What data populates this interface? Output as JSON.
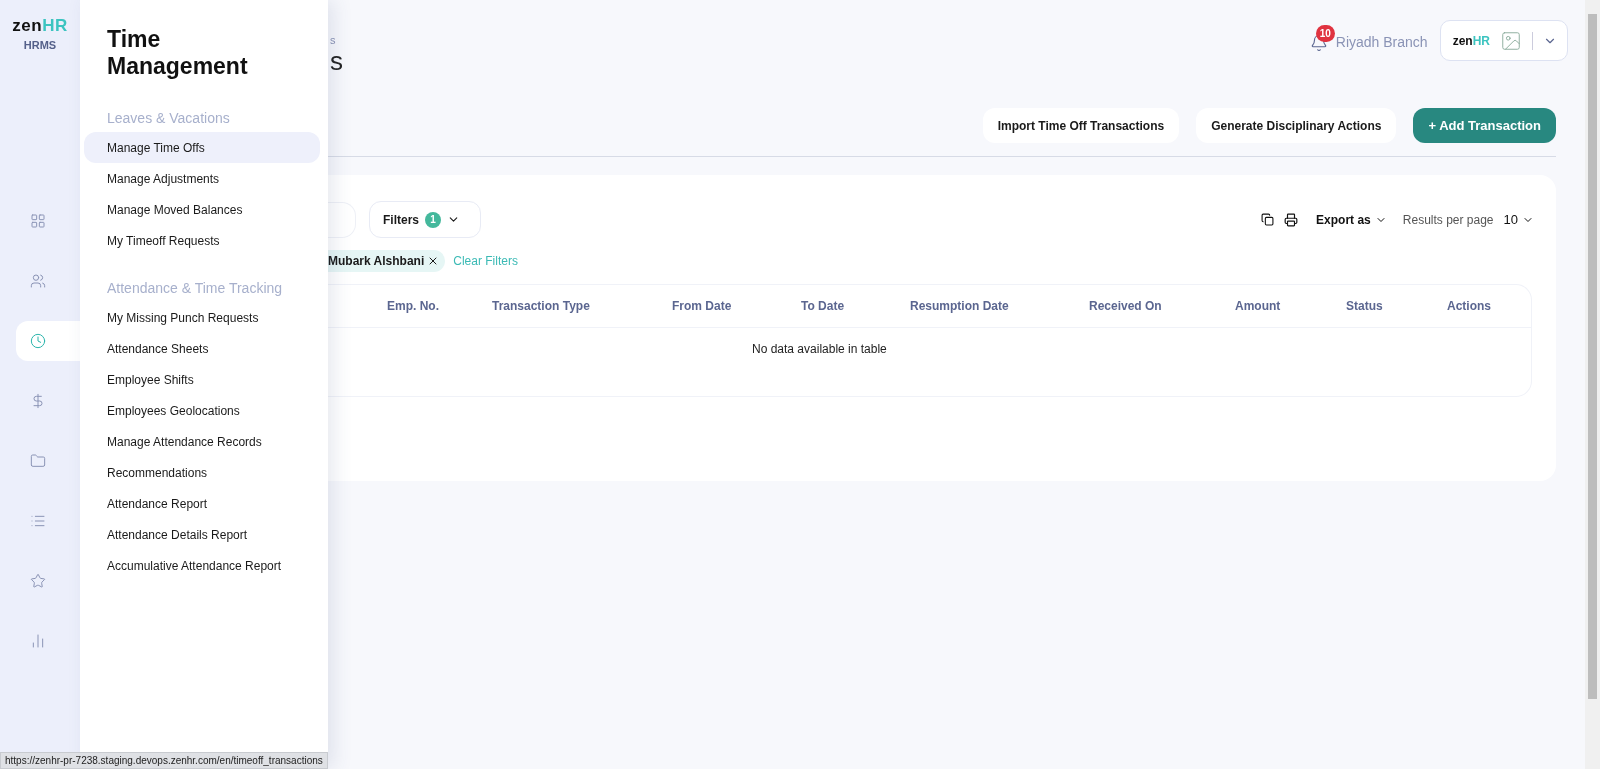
{
  "logo": {
    "part_1": "zen",
    "part_2": "HR",
    "product": "HRMS"
  },
  "rail": [
    {
      "selected": false
    },
    {
      "selected": false
    },
    {
      "selected": true
    },
    {
      "selected": false
    },
    {
      "selected": false
    },
    {
      "selected": false
    },
    {
      "selected": false
    },
    {
      "selected": false
    }
  ],
  "flyout": {
    "title": "Time Management",
    "sections": [
      {
        "heading": "Leaves & Vacations",
        "items": [
          {
            "label": "Manage Time Offs",
            "selected": true
          },
          {
            "label": "Manage Adjustments",
            "selected": false
          },
          {
            "label": "Manage Moved Balances",
            "selected": false
          },
          {
            "label": "My Timeoff Requests",
            "selected": false
          }
        ]
      },
      {
        "heading": "Attendance & Time Tracking",
        "items": [
          {
            "label": "My Missing Punch Requests",
            "selected": false
          },
          {
            "label": "Attendance Sheets",
            "selected": false
          },
          {
            "label": "Employee Shifts",
            "selected": false
          },
          {
            "label": "Employees Geolocations",
            "selected": false
          },
          {
            "label": "Manage Attendance Records",
            "selected": false
          },
          {
            "label": "Recommendations",
            "selected": false
          },
          {
            "label": "Attendance Report",
            "selected": false
          },
          {
            "label": "Attendance Details Report",
            "selected": false
          },
          {
            "label": "Accumulative Attendance Report",
            "selected": false
          }
        ]
      }
    ]
  },
  "header": {
    "breadcrumb": "s",
    "title": "s",
    "notifications": "10",
    "branch": "Riyadh Branch",
    "profile_logo": {
      "part_1": "zen",
      "part_2": "HR"
    }
  },
  "actions": [
    {
      "label": "Import Time Off Transactions",
      "kind": "outline"
    },
    {
      "label": "Generate Disciplinary Actions",
      "kind": "outline"
    },
    {
      "label": "+ Add Transaction",
      "kind": "primary"
    }
  ],
  "toolbar": {
    "filters": {
      "label": "Filters",
      "count": "1"
    },
    "export": "Export as",
    "results_label": "Results per page",
    "results_value": "10"
  },
  "active_filters": {
    "chip": "Mubark Alshbani",
    "clear": "Clear Filters"
  },
  "table": {
    "columns": [
      "Emp. No.",
      "Transaction Type",
      "From Date",
      "To Date",
      "Resumption Date",
      "Received On",
      "Amount",
      "Status",
      "Actions"
    ],
    "empty": "No data available in table"
  },
  "status_url": "https://zenhr-pr-7238.staging.devops.zenhr.com/en/timeoff_transactions"
}
